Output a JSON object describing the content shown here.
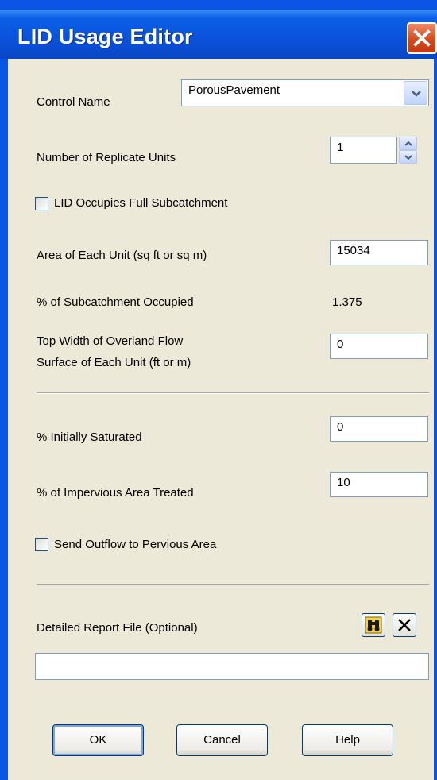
{
  "window": {
    "title": "LID Usage Editor",
    "close_icon": "close-icon"
  },
  "control_name": {
    "label": "Control Name",
    "value": "PorousPavement"
  },
  "replicates": {
    "label": "Number of Replicate Units",
    "value": "1"
  },
  "full_subcatchment": {
    "label": "LID Occupies Full Subcatchment",
    "checked": false
  },
  "area": {
    "label": "Area of Each Unit (sq ft or sq m)",
    "value": "15034"
  },
  "pct_occupied": {
    "label": "% of Subcatchment Occupied",
    "value": "1.375"
  },
  "top_width": {
    "label_line1": "Top Width of Overland Flow",
    "label_line2": "Surface of Each Unit (ft or m)",
    "value": "0"
  },
  "initially_saturated": {
    "label": "% Initially Saturated",
    "value": "0"
  },
  "impervious_treated": {
    "label": "% of Impervious Area Treated",
    "value": "10"
  },
  "send_outflow": {
    "label": "Send Outflow to Pervious Area",
    "checked": false
  },
  "report_file": {
    "label": "Detailed Report File (Optional)",
    "value": "",
    "browse_icon": "binoculars-icon",
    "clear_icon": "clear-icon"
  },
  "buttons": {
    "ok": "OK",
    "cancel": "Cancel",
    "help": "Help"
  },
  "colors": {
    "titlebar": "#0a4fd6",
    "face": "#ece9d8",
    "close": "#d44a1c"
  }
}
